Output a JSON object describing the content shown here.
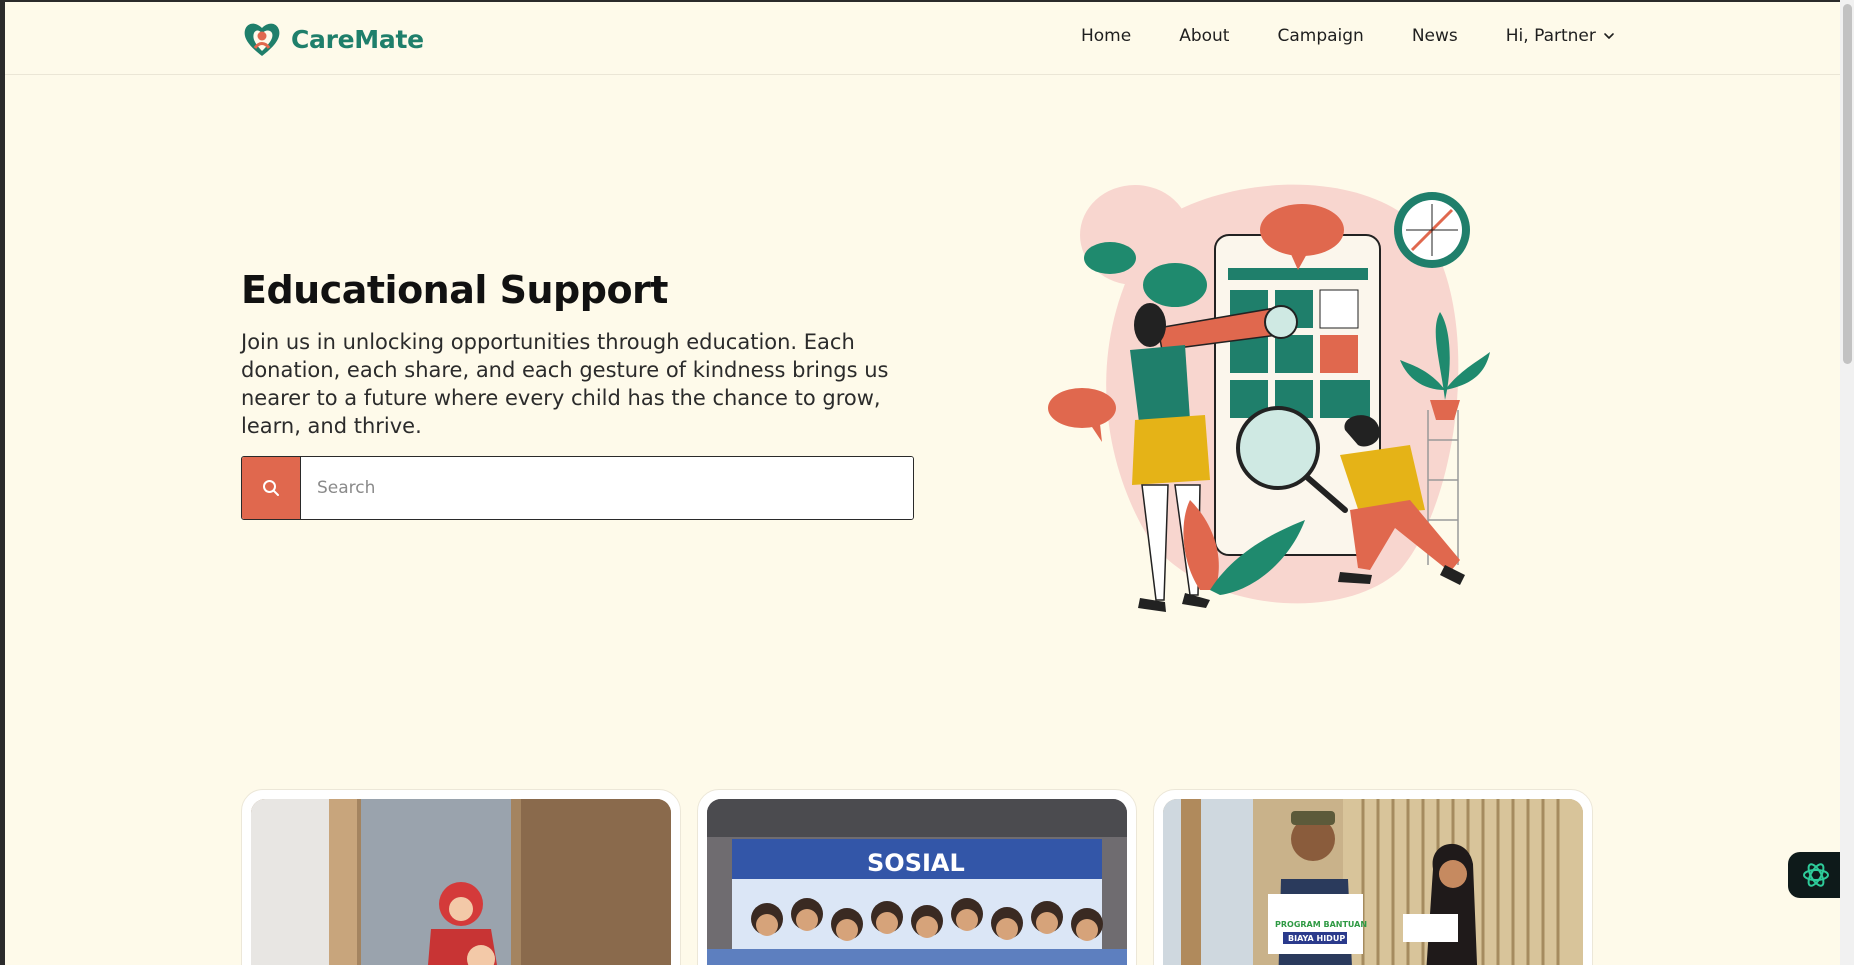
{
  "brand": {
    "name": "CareMate",
    "primary_color": "#1f7f6b",
    "accent_color": "#e0684e",
    "logo_icon": "heart-people-logo"
  },
  "nav": {
    "items": [
      {
        "label": "Home"
      },
      {
        "label": "About"
      },
      {
        "label": "Campaign"
      },
      {
        "label": "News"
      }
    ],
    "user_label": "Hi, Partner"
  },
  "hero": {
    "title": "Educational Support",
    "description": "Join us in unlocking opportunities through education. Each donation, each share, and each gesture of kindness brings us nearer to a future where every child has the chance to grow, learn, and thrive.",
    "search_placeholder": "Search",
    "search_value": ""
  },
  "cards": [
    {
      "image": "children-in-shelter-photo",
      "overlay_text": ""
    },
    {
      "image": "community-group-banner-photo",
      "overlay_text": "SOSIAL"
    },
    {
      "image": "aid-program-handover-photo",
      "overlay_text": "PROGRAM BANTUAN BIAYA HIDUP"
    }
  ],
  "assistant": {
    "icon": "openai-assistant-icon"
  }
}
